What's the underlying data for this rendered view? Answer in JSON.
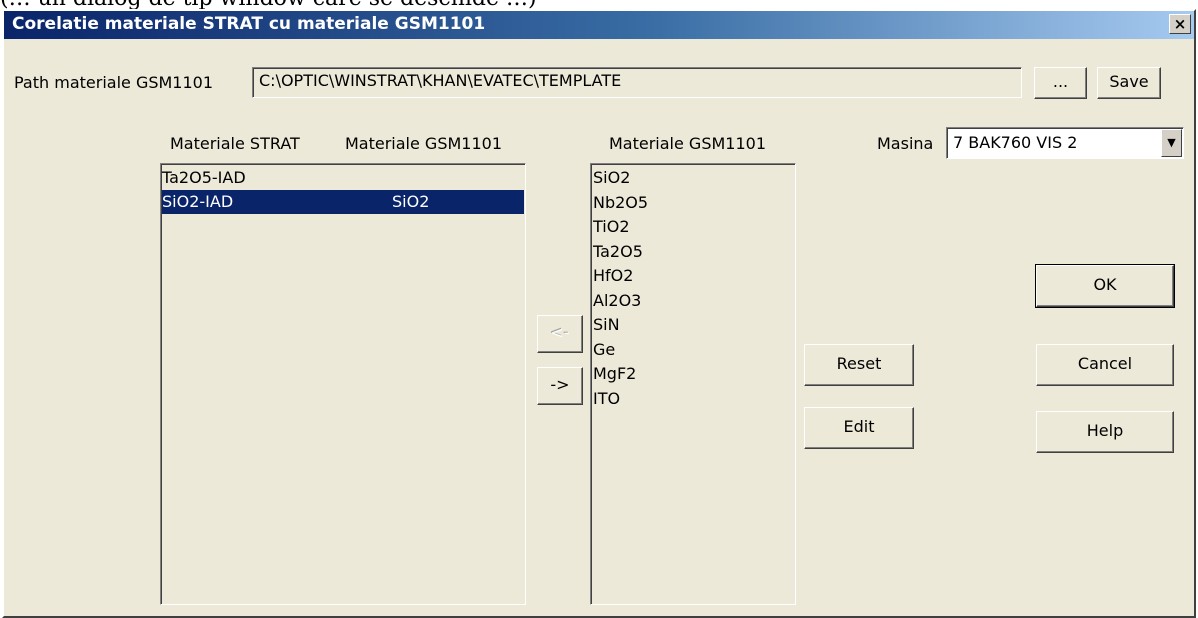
{
  "cut_text": "(… un dialog de tip window care se deschide …)",
  "window": {
    "title": "Corelatie materiale STRAT cu materiale GSM1101",
    "close_label": "×"
  },
  "path": {
    "label": "Path materiale GSM1101",
    "value": "C:\\OPTIC\\WINSTRAT\\KHAN\\EVATEC\\TEMPLATE",
    "browse_label": "...",
    "save_label": "Save"
  },
  "left_list": {
    "header_strat": "Materiale STRAT",
    "header_gsm": "Materiale GSM1101",
    "rows": [
      {
        "strat": "Ta2O5-IAD",
        "gsm": ""
      },
      {
        "strat": "SiO2-IAD",
        "gsm": "SiO2",
        "selected": true
      }
    ]
  },
  "move_buttons": {
    "left_label": "<-",
    "right_label": "->"
  },
  "right_list": {
    "header": "Materiale GSM1101",
    "items": [
      "SiO2",
      "Nb2O5",
      "TiO2",
      "Ta2O5",
      "HfO2",
      "Al2O3",
      "SiN",
      "Ge",
      "MgF2",
      "ITO"
    ]
  },
  "masina": {
    "label": "Masina",
    "selected": "7  BAK760 VIS 2"
  },
  "buttons": {
    "reset": "Reset",
    "edit": "Edit",
    "ok": "OK",
    "cancel": "Cancel",
    "help": "Help"
  },
  "colors": {
    "dialog_bg": "#ece9d8",
    "title_start": "#0a246a",
    "title_end": "#a6caf0",
    "selection": "#0a246a"
  }
}
